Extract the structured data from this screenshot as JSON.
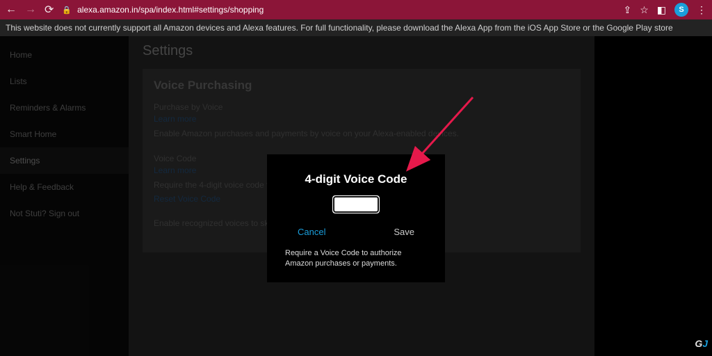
{
  "browser": {
    "url": "alexa.amazon.in/spa/index.html#settings/shopping",
    "profile_letter": "S"
  },
  "banner": {
    "text": "This website does not currently support all Amazon devices and Alexa features. For full functionality, please download the Alexa App from the iOS App Store or the Google Play store"
  },
  "sidebar": {
    "items": [
      {
        "label": "Home"
      },
      {
        "label": "Lists"
      },
      {
        "label": "Reminders & Alarms"
      },
      {
        "label": "Smart Home"
      },
      {
        "label": "Settings"
      },
      {
        "label": "Help & Feedback"
      },
      {
        "label": "Not Stuti? Sign out"
      }
    ]
  },
  "content": {
    "page_title": "Settings",
    "card_title": "Voice Purchasing",
    "sections": {
      "purchase_by_voice": {
        "label": "Purchase by Voice",
        "learn_more": "Learn more",
        "desc": "Enable Amazon purchases and payments by voice on your Alexa-enabled devices."
      },
      "voice_code": {
        "label": "Voice Code",
        "learn_more": "Learn more",
        "desc": "Require the 4-digit voice code to confirm Am",
        "reset": "Reset Voice Code"
      },
      "recognized_voices": {
        "desc": "Enable recognized voices to skip giving the V"
      }
    }
  },
  "modal": {
    "title": "4-digit Voice Code",
    "cancel": "Cancel",
    "save": "Save",
    "desc": "Require a Voice Code to authorize Amazon purchases or payments."
  },
  "watermark": {
    "g": "G",
    "j": "J"
  }
}
